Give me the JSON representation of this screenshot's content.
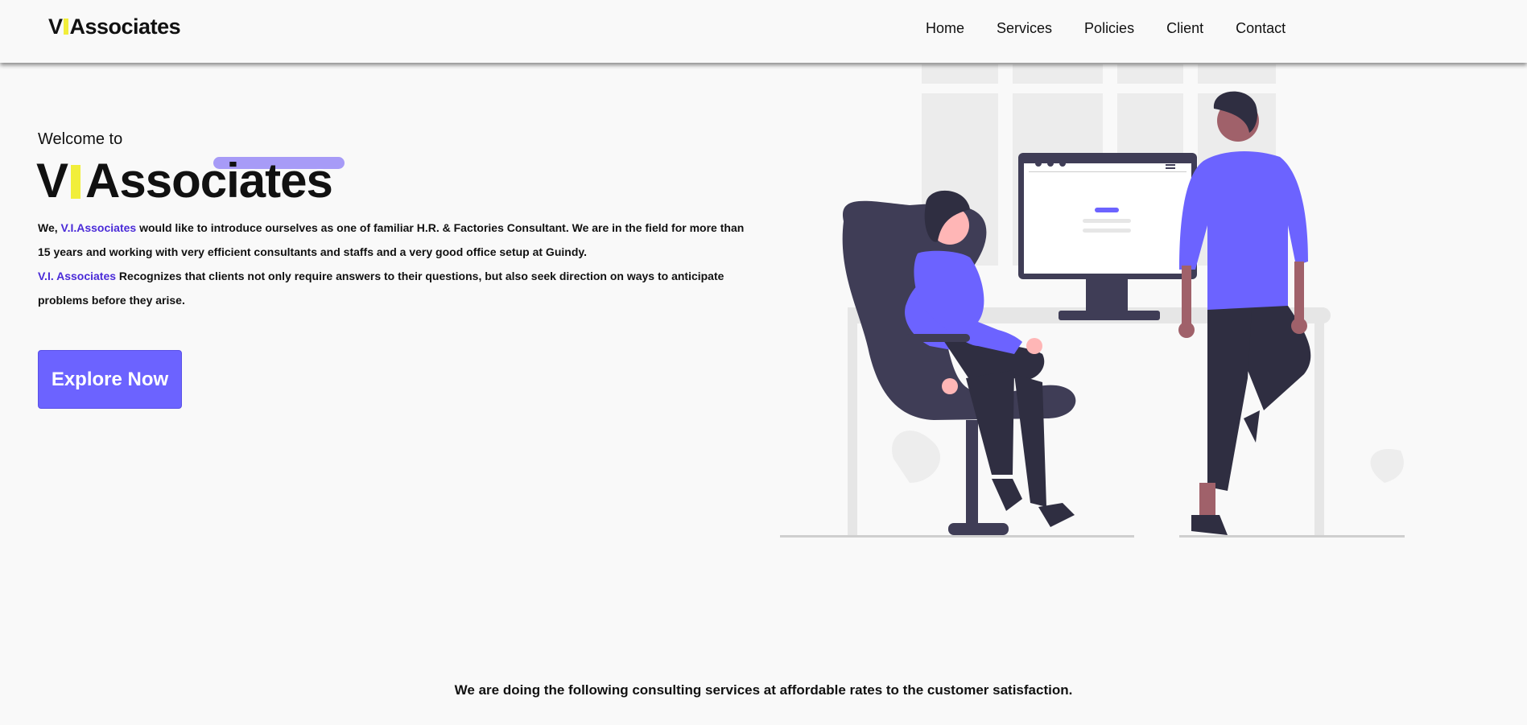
{
  "header": {
    "logo_prefix": "V",
    "logo_suffix": "Associates",
    "nav": [
      "Home",
      "Services",
      "Policies",
      "Client",
      "Contact"
    ]
  },
  "hero": {
    "welcome": "Welcome to",
    "title_prefix": "V",
    "title_suffix": "Associates",
    "p1_start": "We, ",
    "p1_link": "V.I.Associates",
    "p1_end": " would like to introduce ourselves as one of familiar H.R. & Factories Consultant. We are in the field for more than 15 years and working with very efficient consultants and staffs and a very good office setup at Guindy.",
    "p2_link": "V.I. Associates",
    "p2_end": " Recognizes that clients not only require answers to their questions, but also seek direction on ways to anticipate problems before they arise.",
    "button": "Explore Now"
  },
  "tagline": "We are doing the following consulting services at affordable rates to the customer satisfaction.",
  "colors": {
    "accent": "#6c63ff",
    "brand_yellow": "#f1ee3a",
    "link": "#4a2bd8",
    "dark": "#3f3d56"
  }
}
